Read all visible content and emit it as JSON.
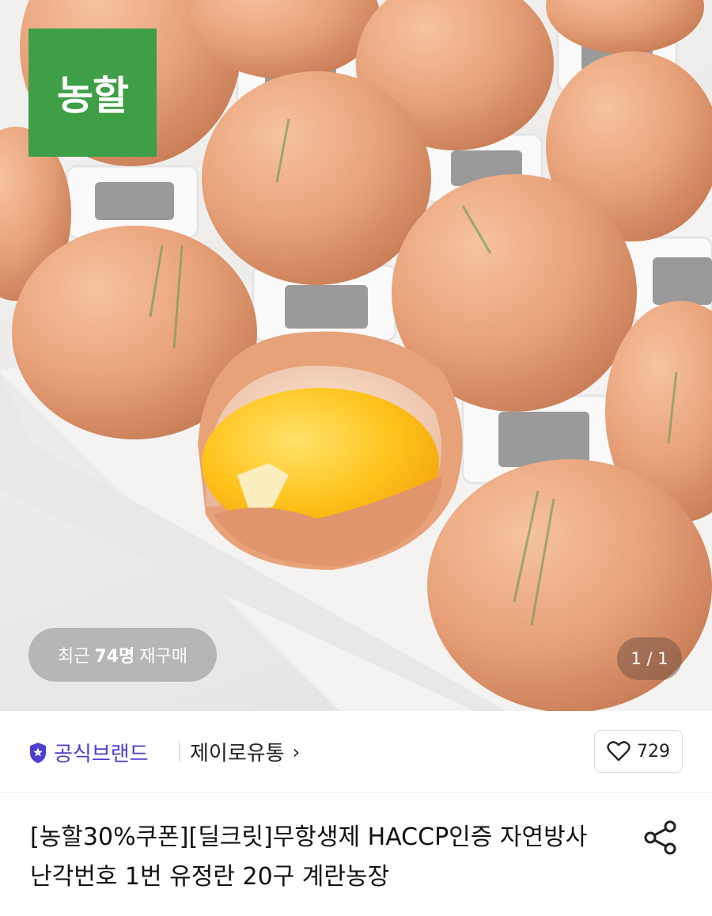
{
  "hero": {
    "brand_logo_text": "농할",
    "brand_logo_color": "#3f9f46",
    "repurchase": {
      "prefix": "최근",
      "count": "74명",
      "suffix": "재구매"
    },
    "page_indicator": "1 / 1"
  },
  "brand_row": {
    "official_label": "공식브랜드",
    "official_color": "#4a3fd0",
    "seller_name": "제이로유통",
    "seller_chevron": "›",
    "wish_count": "729"
  },
  "product": {
    "title": "[농할30%쿠폰][딜크릿]무항생제 HACCP인증 자연방사 난각번호 1번 유정란 20구 계란농장"
  },
  "icons": [
    "shield-star-icon",
    "chevron-right-icon",
    "heart-icon",
    "share-icon"
  ]
}
